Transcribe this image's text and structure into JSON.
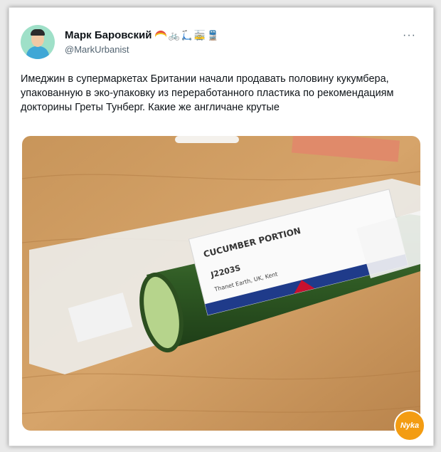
{
  "tweet": {
    "display_name": "Марк Баровский",
    "handle": "@MarkUrbanist",
    "emojis": [
      "rainbow",
      "bicycle",
      "scooter",
      "tram",
      "train"
    ],
    "more_label": "···",
    "text": "Имеджин в супермаркетах Британии начали продавать половину кукумбера, упакованную в эко-упаковку из переработанного пластика по рекомендациям докторины Греты Тунберг. Какие же англичане крутые"
  },
  "photo": {
    "label_title": "CUCUMBER PORTION",
    "label_code": "J2203S",
    "label_origin": "Thanet Earth, UK, Kent"
  },
  "watermark": {
    "text": "Nyka"
  }
}
